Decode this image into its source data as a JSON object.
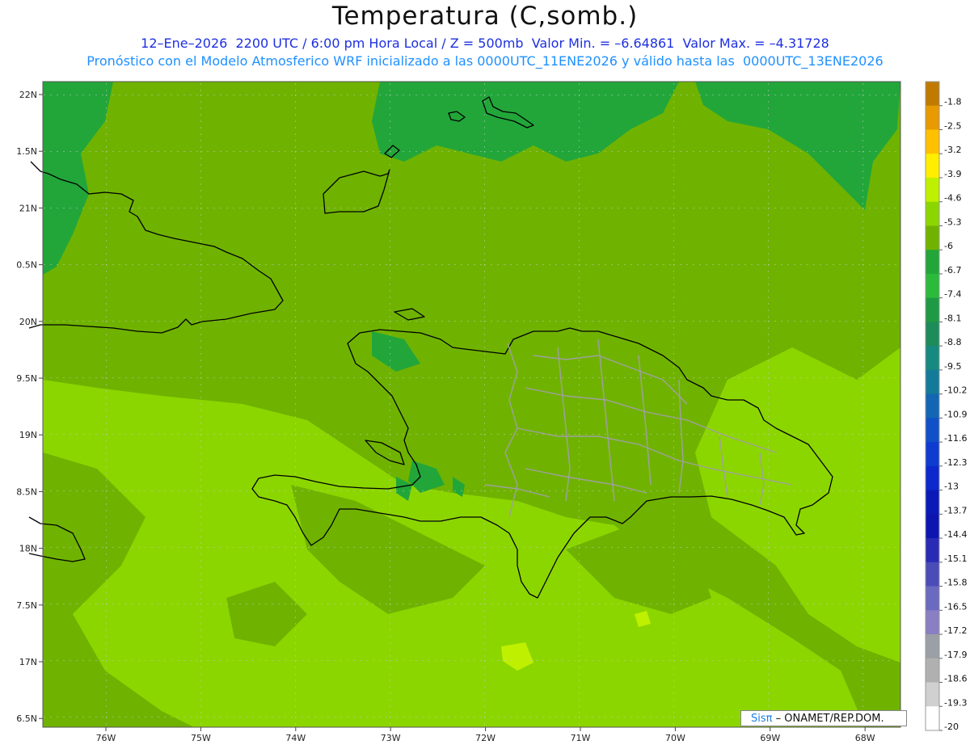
{
  "title": "Temperatura (C,somb.)",
  "subtitle_line1": "12–Ene–2026  2200 UTC / 6:00 pm Hora Local / Z = 500mb  Valor Min. = –6.64861  Valor Max. = –4.31728",
  "subtitle_line2": "Pronóstico con el Modelo Atmosferico WRF inicializado a las 0000UTC_11ENE2026 y válido hasta las  0000UTC_13ENE2026",
  "credit": {
    "brand": "Sisπ",
    "text": "– ONAMET/REP.DOM."
  },
  "lat_labels": [
    "22N",
    "1.5N",
    "21N",
    "0.5N",
    "20N",
    "9.5N",
    "19N",
    "8.5N",
    "18N",
    "7.5N",
    "17N",
    "6.5N"
  ],
  "lon_labels": [
    "76W",
    "75W",
    "74W",
    "73W",
    "72W",
    "71W",
    "70W",
    "69W",
    "68W"
  ],
  "colorbar": {
    "labels": [
      "-1.8",
      "-2.5",
      "-3.2",
      "-3.9",
      "-4.6",
      "-5.3",
      "-6",
      "-6.7",
      "-7.4",
      "-8.1",
      "-8.8",
      "-9.5",
      "-10.2",
      "-10.9",
      "-11.6",
      "-12.3",
      "-13",
      "-13.7",
      "-14.4",
      "-15.1",
      "-15.8",
      "-16.5",
      "-17.2",
      "-17.9",
      "-18.6",
      "-19.3",
      "-20"
    ],
    "colors": [
      "#c07a00",
      "#e89a00",
      "#ffc000",
      "#ffee00",
      "#bff000",
      "#8cd600",
      "#6fb300",
      "#22a63a",
      "#2cba3a",
      "#1f9a44",
      "#1d8b5a",
      "#168a80",
      "#147a9a",
      "#1266b4",
      "#1151c8",
      "#0f3cd0",
      "#0d28cc",
      "#0a1ab8",
      "#0d15b0",
      "#2a2bb5",
      "#4b4cb8",
      "#6a6bc0",
      "#8a7fc2",
      "#9aa0a6",
      "#b0b0b0",
      "#d0d0d0",
      "#ffffff"
    ]
  },
  "field_colors": {
    "dark": "#22a63a",
    "mid": "#6fb300",
    "light": "#8cd600",
    "lighter": "#bff000"
  }
}
